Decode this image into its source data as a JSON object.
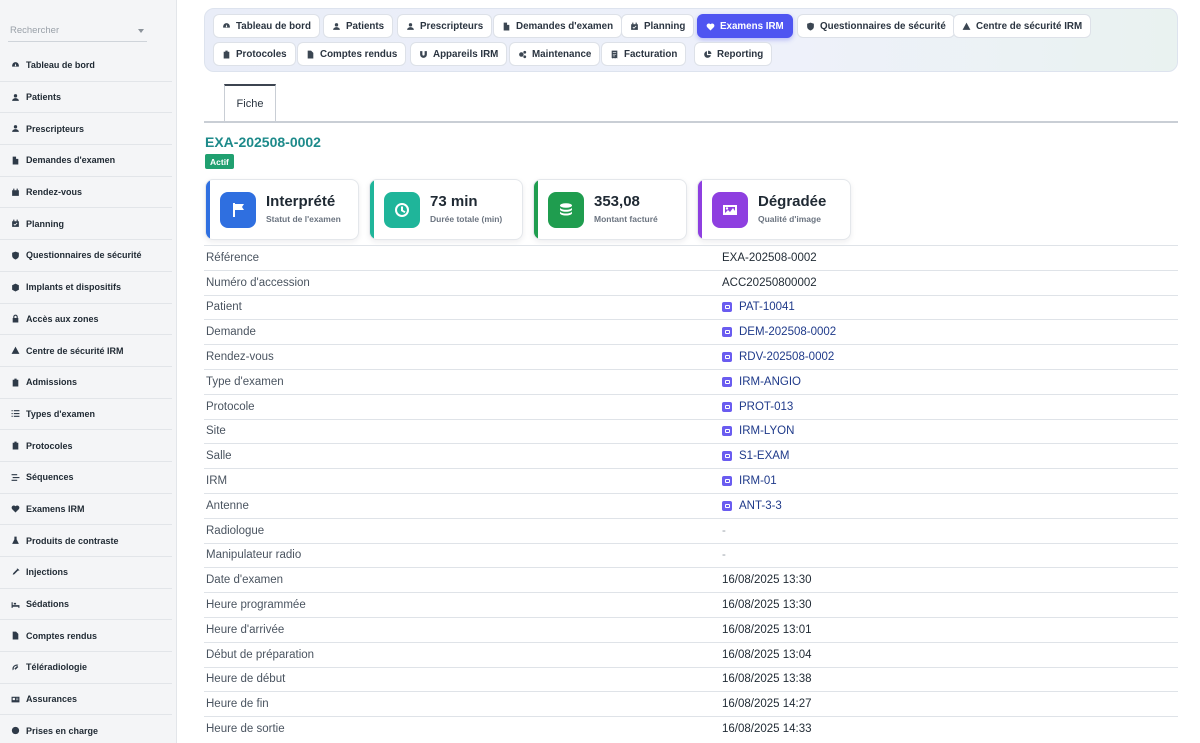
{
  "sidebar": {
    "search_placeholder": "Rechercher",
    "items": [
      {
        "label": "Tableau de bord",
        "icon": "dashboard-icon"
      },
      {
        "label": "Patients",
        "icon": "user-icon"
      },
      {
        "label": "Prescripteurs",
        "icon": "user-doctor-icon"
      },
      {
        "label": "Demandes d'examen",
        "icon": "file-icon"
      },
      {
        "label": "Rendez-vous",
        "icon": "calendar-icon"
      },
      {
        "label": "Planning",
        "icon": "calendar-check-icon"
      },
      {
        "label": "Questionnaires de sécurité",
        "icon": "shield-icon"
      },
      {
        "label": "Implants et dispositifs",
        "icon": "box-icon"
      },
      {
        "label": "Accès aux zones",
        "icon": "lock-icon"
      },
      {
        "label": "Centre de sécurité IRM",
        "icon": "warning-icon"
      },
      {
        "label": "Admissions",
        "icon": "clipboard-icon"
      },
      {
        "label": "Types d'examen",
        "icon": "list-icon"
      },
      {
        "label": "Protocoles",
        "icon": "clipboard-list-icon"
      },
      {
        "label": "Séquences",
        "icon": "stream-icon"
      },
      {
        "label": "Examens IRM",
        "icon": "heartbeat-icon"
      },
      {
        "label": "Produits de contraste",
        "icon": "flask-icon"
      },
      {
        "label": "Injections",
        "icon": "syringe-icon"
      },
      {
        "label": "Sédations",
        "icon": "bed-icon"
      },
      {
        "label": "Comptes rendus",
        "icon": "file-signature-icon"
      },
      {
        "label": "Téléradiologie",
        "icon": "satellite-icon"
      },
      {
        "label": "Assurances",
        "icon": "id-card-icon"
      },
      {
        "label": "Prises en charge",
        "icon": "circle-icon"
      }
    ]
  },
  "topnav": {
    "items": [
      {
        "label": "Tableau de bord",
        "icon": "dashboard-icon",
        "active": false
      },
      {
        "label": "Patients",
        "icon": "user-icon",
        "active": false
      },
      {
        "label": "Prescripteurs",
        "icon": "user-doctor-icon",
        "active": false
      },
      {
        "label": "Demandes d'examen",
        "icon": "file-icon",
        "active": false
      },
      {
        "label": "Planning",
        "icon": "calendar-check-icon",
        "active": false
      },
      {
        "label": "Examens IRM",
        "icon": "heartbeat-icon",
        "active": true
      },
      {
        "label": "Questionnaires de sécurité",
        "icon": "shield-icon",
        "active": false
      },
      {
        "label": "Centre de sécurité IRM",
        "icon": "warning-icon",
        "active": false
      },
      {
        "label": "Protocoles",
        "icon": "clipboard-list-icon",
        "active": false
      },
      {
        "label": "Comptes rendus",
        "icon": "file-signature-icon",
        "active": false
      },
      {
        "label": "Appareils IRM",
        "icon": "magnet-icon",
        "active": false
      },
      {
        "label": "Maintenance",
        "icon": "cogs-icon",
        "active": false
      },
      {
        "label": "Facturation",
        "icon": "invoice-icon",
        "active": false
      },
      {
        "label": "Reporting",
        "icon": "chart-pie-icon",
        "active": false
      }
    ]
  },
  "tabs": {
    "fiche": "Fiche"
  },
  "record": {
    "title": "EXA-202508-0002",
    "status_badge": "Actif"
  },
  "cards": [
    {
      "value": "Interprété",
      "label": "Statut de l'examen",
      "color": "#2f6fe0",
      "icon": "flag-icon"
    },
    {
      "value": "73 min",
      "label": "Durée totale (min)",
      "color": "#1fb59a",
      "icon": "clock-icon"
    },
    {
      "value": "353,08",
      "label": "Montant facturé",
      "color": "#1f9d4f",
      "icon": "coins-icon"
    },
    {
      "value": "Dégradée",
      "label": "Qualité d'image",
      "color": "#8e3fe0",
      "icon": "image-icon"
    }
  ],
  "details": [
    {
      "key": "Référence",
      "value": "EXA-202508-0002",
      "type": "text"
    },
    {
      "key": "Numéro d'accession",
      "value": "ACC20250800002",
      "type": "text"
    },
    {
      "key": "Patient",
      "value": "PAT-10041",
      "type": "link"
    },
    {
      "key": "Demande",
      "value": "DEM-202508-0002",
      "type": "link"
    },
    {
      "key": "Rendez-vous",
      "value": "RDV-202508-0002",
      "type": "link"
    },
    {
      "key": "Type d'examen",
      "value": "IRM-ANGIO",
      "type": "link"
    },
    {
      "key": "Protocole",
      "value": "PROT-013",
      "type": "link"
    },
    {
      "key": "Site",
      "value": "IRM-LYON",
      "type": "link"
    },
    {
      "key": "Salle",
      "value": "S1-EXAM",
      "type": "link"
    },
    {
      "key": "IRM",
      "value": "IRM-01",
      "type": "link"
    },
    {
      "key": "Antenne",
      "value": "ANT-3-3",
      "type": "link"
    },
    {
      "key": "Radiologue",
      "value": "-",
      "type": "dash"
    },
    {
      "key": "Manipulateur radio",
      "value": "-",
      "type": "dash"
    },
    {
      "key": "Date d'examen",
      "value": "16/08/2025 13:30",
      "type": "text"
    },
    {
      "key": "Heure programmée",
      "value": "16/08/2025 13:30",
      "type": "text"
    },
    {
      "key": "Heure d'arrivée",
      "value": "16/08/2025 13:01",
      "type": "text"
    },
    {
      "key": "Début de préparation",
      "value": "16/08/2025 13:04",
      "type": "text"
    },
    {
      "key": "Heure de début",
      "value": "16/08/2025 13:38",
      "type": "text"
    },
    {
      "key": "Heure de fin",
      "value": "16/08/2025 14:27",
      "type": "text"
    },
    {
      "key": "Heure de sortie",
      "value": "16/08/2025 14:33",
      "type": "text"
    }
  ]
}
